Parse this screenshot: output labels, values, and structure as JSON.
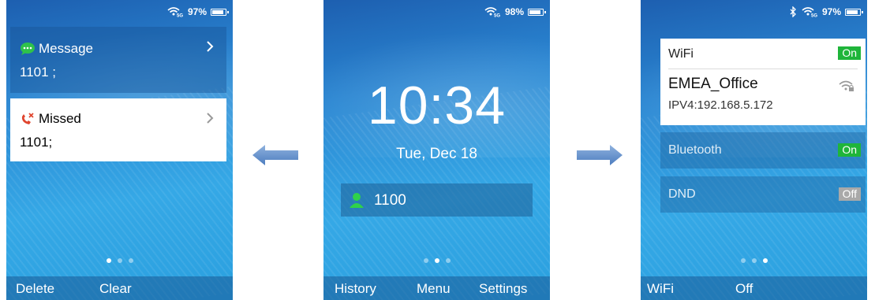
{
  "screens": [
    {
      "status": {
        "battery": "97%"
      },
      "cards": [
        {
          "title": "Message",
          "value": "1101 ;"
        },
        {
          "title": "Missed",
          "value": "1101;"
        }
      ],
      "softkeys": {
        "left": "Delete",
        "middle": "Clear"
      }
    },
    {
      "status": {
        "battery": "98%"
      },
      "clock": "10:34",
      "date": "Tue, Dec 18",
      "account": "1100",
      "softkeys": {
        "left": "History",
        "middle": "Menu",
        "right": "Settings"
      }
    },
    {
      "status": {
        "battery": "97%"
      },
      "wifi": {
        "label": "WiFi",
        "toggle": "On",
        "ssid": "EMEA_Office",
        "ip": "IPV4:192.168.5.172"
      },
      "bluetooth": {
        "label": "Bluetooth",
        "toggle": "On"
      },
      "dnd": {
        "label": "DND",
        "toggle": "Off"
      },
      "softkeys": {
        "left": "WiFi",
        "middle": "Off"
      }
    }
  ],
  "icons": {
    "message": "chat-bubble-icon",
    "missed": "missed-call-icon",
    "account": "person-icon",
    "wifi_status": "wifi-5g-icon",
    "bluetooth": "bluetooth-icon",
    "battery": "battery-icon",
    "wifi_lock": "wifi-lock-icon",
    "arrow_left": "arrow-left-icon",
    "arrow_right": "arrow-right-icon"
  },
  "colors": {
    "toggle_on": "#1fb53a",
    "toggle_off": "#a9a9a9",
    "message_icon": "#2fc24a",
    "missed_icon": "#e0452e",
    "account_icon": "#2fd24a"
  },
  "pagination": {
    "screen1_active": 1,
    "screen2_active": 2,
    "screen3_active": 3,
    "total": 3
  }
}
